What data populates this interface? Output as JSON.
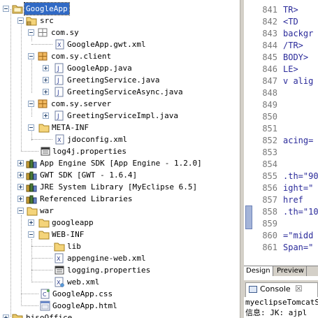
{
  "tree": {
    "items": [
      {
        "label": "GoogleApp",
        "icon": "project-icon"
      },
      {
        "label": "src",
        "icon": "source-folder-icon"
      },
      {
        "label": "com.sy",
        "icon": "package-icon"
      },
      {
        "label": "GoogleApp.gwt.xml",
        "icon": "xml-file-icon"
      },
      {
        "label": "com.sy.client",
        "icon": "package-icon"
      },
      {
        "label": "GoogleApp.java",
        "icon": "java-file-icon"
      },
      {
        "label": "GreetingService.java",
        "icon": "java-file-icon"
      },
      {
        "label": "GreetingServiceAsync.java",
        "icon": "java-file-icon"
      },
      {
        "label": "com.sy.server",
        "icon": "package-icon"
      },
      {
        "label": "GreetingServiceImpl.java",
        "icon": "java-file-icon"
      },
      {
        "label": "META-INF",
        "icon": "folder-icon"
      },
      {
        "label": "jdoconfig.xml",
        "icon": "xml-file-icon"
      },
      {
        "label": "log4j.properties",
        "icon": "properties-file-icon"
      },
      {
        "label": "App Engine SDK [App Engine - 1.2.0]",
        "icon": "library-icon"
      },
      {
        "label": "GWT SDK [GWT - 1.6.4]",
        "icon": "library-icon"
      },
      {
        "label": "JRE System Library [MyEclipse 6.5]",
        "icon": "library-icon"
      },
      {
        "label": "Referenced Libraries",
        "icon": "library-icon"
      },
      {
        "label": "war",
        "icon": "folder-icon"
      },
      {
        "label": "googleapp",
        "icon": "folder-icon"
      },
      {
        "label": "WEB-INF",
        "icon": "folder-icon"
      },
      {
        "label": "lib",
        "icon": "folder-icon"
      },
      {
        "label": "appengine-web.xml",
        "icon": "xml-file-icon"
      },
      {
        "label": "logging.properties",
        "icon": "properties-file-icon"
      },
      {
        "label": "web.xml",
        "icon": "xml-file-icon"
      },
      {
        "label": "GoogleApp.css",
        "icon": "css-file-icon"
      },
      {
        "label": "GoogleApp.html",
        "icon": "html-file-icon"
      },
      {
        "label": "hisoOffice",
        "icon": "project-icon"
      }
    ]
  },
  "editor": {
    "line_numbers": [
      "841",
      "842",
      "843",
      "844",
      "845",
      "846",
      "847",
      "848",
      "849",
      "850",
      "851",
      "852",
      "853",
      "854",
      "855",
      "856",
      "857",
      "858",
      "859",
      "860",
      "861"
    ],
    "code_lines": [
      "TR>",
      " <TD",
      " backgr",
      "/TR>",
      "BODY>",
      "LE>",
      "v alig",
      "",
      "",
      "",
      "",
      "acing=",
      "",
      "",
      ".th=\"90",
      "ight=\"",
      "  href",
      ".th=\"10",
      "",
      "=\"midd",
      "Span=\""
    ],
    "tabs": [
      "Design",
      "Preview"
    ]
  },
  "console": {
    "tab_label": "Console",
    "close_glyph": "☒",
    "lines": [
      "myeclipseTomcatSer",
      "信息: JK: ajpl"
    ]
  }
}
